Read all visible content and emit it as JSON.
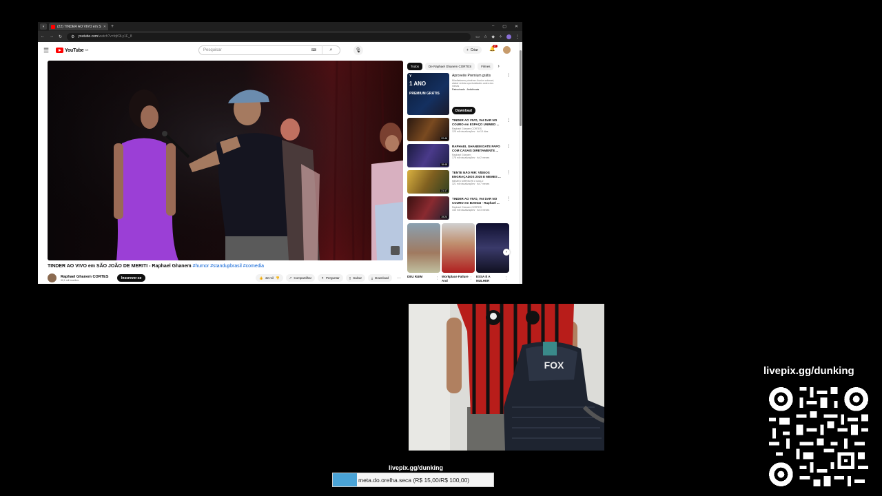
{
  "browser": {
    "tab_title": "(22) TINDER AO VIVO em S",
    "new_tab": "+",
    "url_host": "youtube.com",
    "url_path": "/watch?v=fqK9Ly1F_8",
    "window_controls": [
      "–",
      "▢",
      "✕"
    ]
  },
  "youtube": {
    "logo_text": "YouTube",
    "logo_country": "BR",
    "search_placeholder": "Pesquisar",
    "create_label": "Criar",
    "notifications_count": "9+"
  },
  "video": {
    "title": "TINDER AO VIVO em SÃO JOÃO DE MERITI - Raphael Ghanem",
    "hashtags": "#humor #standupbrasil #comedia",
    "channel_name": "Raphael Ghanem CORTES",
    "channel_subs": "92,1 mil inscritos",
    "subscribe_label": "Inscrever-se",
    "likes": "32 mil",
    "share_label": "Compartilhar",
    "ask_label": "Perguntar",
    "save_label": "Salvar",
    "download_label": "Download"
  },
  "sidebar": {
    "chips": [
      "Todos",
      "De Raphael Ghanem CORTES",
      "Filmes"
    ],
    "ad": {
      "thumb_logo": "Y",
      "thumb_big": "1 ANO",
      "thumb_small": "PREMIUM GRÁTIS",
      "title": "Aproveite Premium grátis",
      "description": "Mindhelmers primême d'union colorant, alatoir revista oportunidades antes dos meses",
      "sponsor": "Patrocinado · Anticlinoais",
      "button": "Download"
    },
    "recommendations": [
      {
        "title": "TINDER AO VIVO, VAI DAR NO COURO em ESPAÇO UNIMED ...",
        "channel": "Raphael Ghanem CORTES",
        "meta": "125 mil visualizações · há 13 dias",
        "duration": "22:46"
      },
      {
        "title": "RAPHAEL GHANEM DATE PAPO COM CASAIS DIRETAMENTE ...",
        "channel": "Raphael Ghanem",
        "meta": "176 mil visualizações · há 2 meses",
        "duration": "18:48"
      },
      {
        "title": "TENTE NÃO RIR: VÍDEOS ENGRAÇADOS 2025 E MEMES ...",
        "channel": "MEMES MIRRIM RI e roles 2",
        "meta": "321 mil visualizações · há 7 meses",
        "duration": "21:17"
      },
      {
        "title": "TINDER AO VIVO, VAI DAR NO COURO em BANGU - Raphael ...",
        "channel": "Raphael Ghanem CORTES",
        "meta": "445 mil visualizações · há 3 meses",
        "duration": "19:24"
      }
    ],
    "shorts": [
      "DEU RUIM",
      "Workplace Failure And",
      "ESSA É A MULHER"
    ]
  },
  "overlay": {
    "livepix_url": "livepix.gg/dunking",
    "goal_label": "livepix.gg/dunking",
    "goal_text": "meta.do.orelha.seca (R$ 15,00/R$ 100,00)",
    "goal_progress": 0.15,
    "goal_color": "#4aa3d6"
  },
  "colors": {
    "youtube_red": "#ff0000",
    "link_blue": "#065fd4",
    "webcam_shirt_red": "#c8201e"
  }
}
